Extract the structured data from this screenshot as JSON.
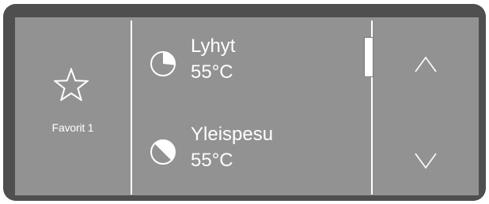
{
  "favorite": {
    "label": "Favorit 1",
    "icon": "star-outline-icon"
  },
  "programs": [
    {
      "name": "Lyhyt",
      "temperature": "55°C",
      "icon": "pie-partial-icon"
    },
    {
      "name": "Yleispesu",
      "temperature": "55°C",
      "icon": "pie-half-icon"
    }
  ],
  "navigation": {
    "up_icon": "chevron-up-icon",
    "down_icon": "chevron-down-icon"
  },
  "colors": {
    "screen": "#929292",
    "bezel": "#4f4f4f",
    "foreground": "#ffffff"
  }
}
